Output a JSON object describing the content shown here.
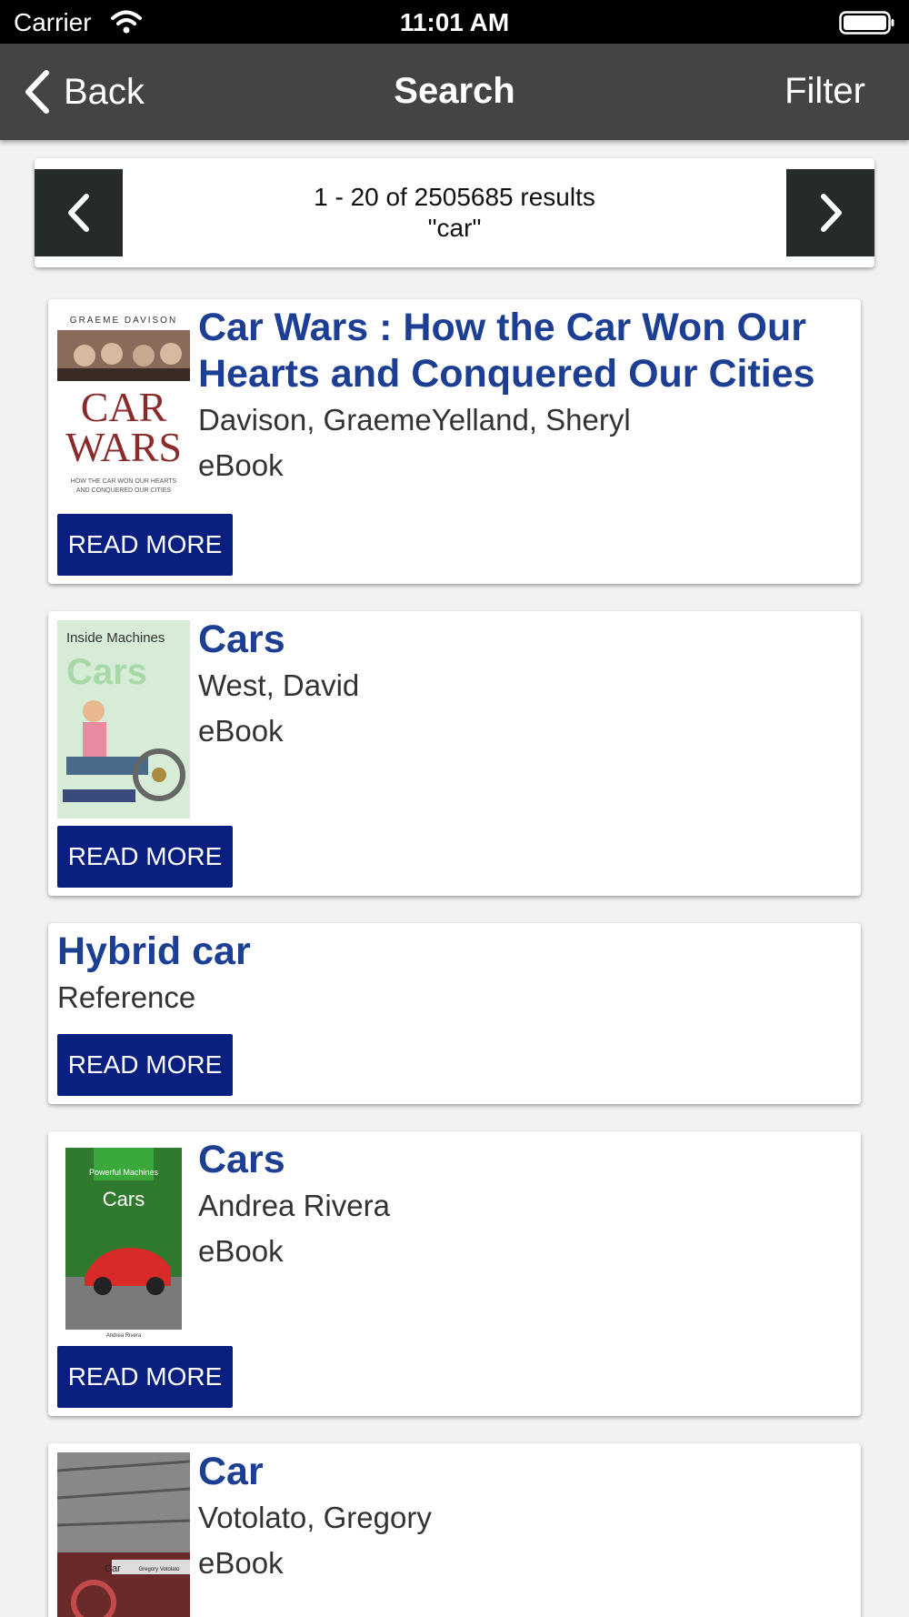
{
  "status_bar": {
    "carrier": "Carrier",
    "time": "11:01 AM"
  },
  "nav": {
    "back_label": "Back",
    "title": "Search",
    "filter_label": "Filter"
  },
  "pager": {
    "summary": "1 - 20 of 2505685 results",
    "query": "\"car\""
  },
  "results": [
    {
      "title": "Car Wars : How the Car Won Our Hearts and Conquered Our Cities",
      "author": "Davison, GraemeYelland, Sheryl",
      "format": "eBook",
      "button": "READ MORE",
      "cover": {
        "top_text": "GRAEME DAVISON",
        "line1": "CAR",
        "line2": "WARS",
        "sub1": "HOW THE CAR WON OUR HEARTS",
        "sub2": "AND CONQUERED OUR CITIES"
      }
    },
    {
      "title": "Cars",
      "author": "West, David",
      "format": "eBook",
      "button": "READ MORE",
      "cover": {
        "top_text": "Inside Machines",
        "title": "Cars"
      }
    },
    {
      "title": "Hybrid car",
      "format": "Reference",
      "button": "READ MORE"
    },
    {
      "title": "Cars",
      "author": "Andrea Rivera",
      "format": "eBook",
      "button": "READ MORE",
      "cover": {
        "banner": "Powerful Machines",
        "title": "Cars",
        "footer": "Andrea Rivera"
      }
    },
    {
      "title": "Car",
      "author": "Votolato, Gregory",
      "format": "eBook",
      "cover": {
        "title": "Car",
        "author": "Gregory Votolato"
      }
    }
  ],
  "colors": {
    "nav_bg": "#444444",
    "title_blue": "#1c3f94",
    "button_blue": "#0a2080",
    "pager_btn": "#252b2b"
  }
}
